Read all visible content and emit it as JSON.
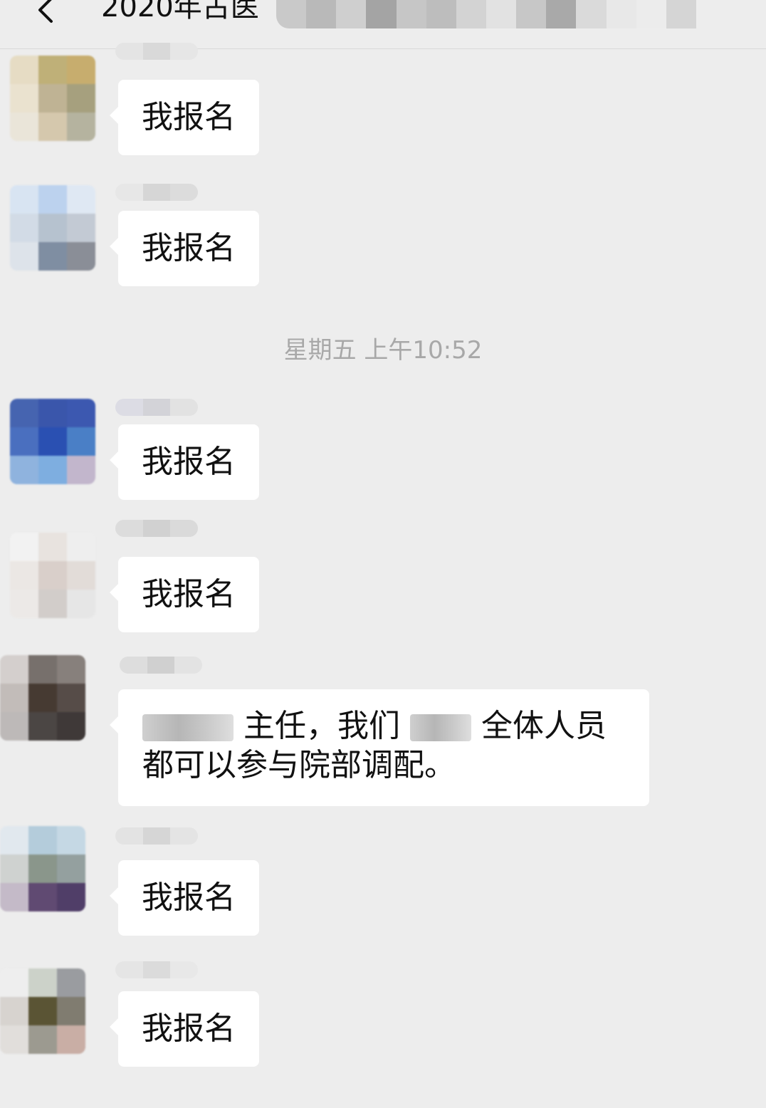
{
  "header": {
    "back_icon": "chevron-left-icon",
    "title": "2020年古医"
  },
  "timestamp": "星期五 上午10:52",
  "messages": [
    {
      "text": "我报名"
    },
    {
      "text": "我报名"
    },
    {
      "text": "我报名"
    },
    {
      "text": "我报名"
    },
    {
      "part1": "主任，我们",
      "part2": "全体人员都可以参与院部调配。"
    },
    {
      "text": "我报名"
    },
    {
      "text": "我报名"
    }
  ],
  "colors": {
    "background": "#ededed",
    "bubble": "#ffffff",
    "timestamp": "#a8a8a8"
  }
}
